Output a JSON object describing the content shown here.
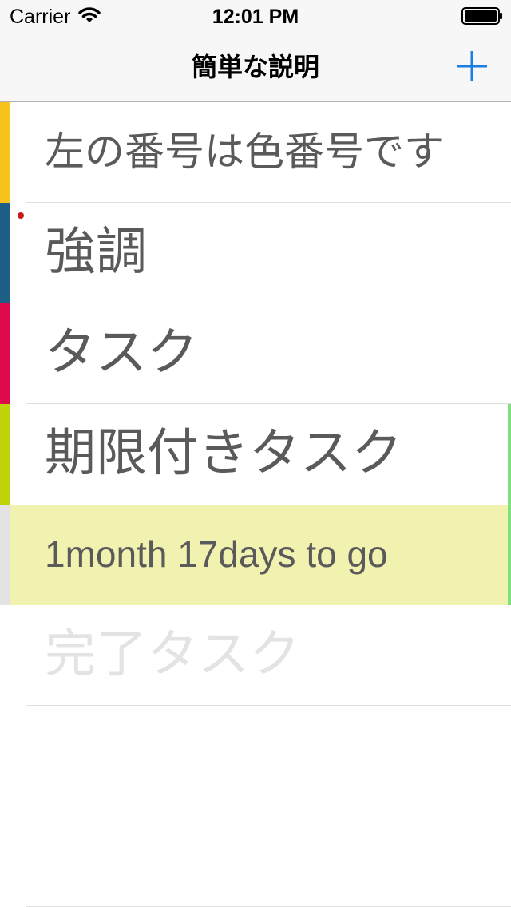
{
  "status_bar": {
    "carrier": "Carrier",
    "time": "12:01 PM",
    "wifi_icon": "wifi-icon",
    "battery_icon": "battery-icon"
  },
  "nav": {
    "title": "簡単な説明",
    "add_icon": "plus-icon"
  },
  "colors": {
    "accent": "#1a7ee6",
    "stripe_yellow": "#f7c21b",
    "stripe_blue": "#1c5e86",
    "stripe_red": "#de0a4c",
    "stripe_lime": "#bed30a",
    "stripe_gray": "#e3e3e3",
    "countdown_bg": "#f1f2b0",
    "due_marker": "#7ee07e",
    "highlight_dot": "#c81a1a",
    "completed_text": "#e3e3e3"
  },
  "rows": [
    {
      "text": "左の番号は色番号です"
    },
    {
      "text": "強調"
    },
    {
      "text": "タスク"
    },
    {
      "text": "期限付きタスク"
    },
    {
      "text": "1month 17days  to go"
    },
    {
      "text": "完了タスク"
    },
    {
      "text": ""
    },
    {
      "text": ""
    }
  ]
}
